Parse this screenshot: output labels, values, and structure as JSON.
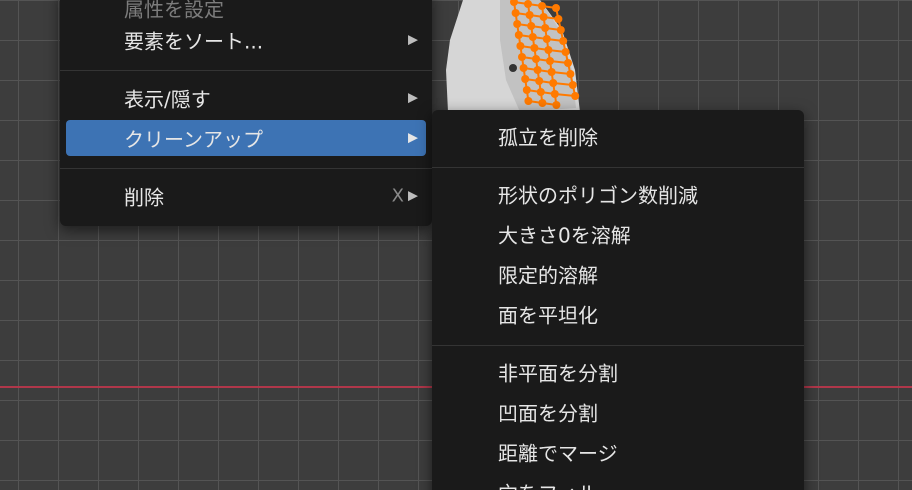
{
  "main_menu": {
    "items": [
      {
        "label": "属性を設定",
        "arrow": ""
      },
      {
        "label": "要素をソート...",
        "arrow": "▶"
      },
      {
        "label": "表示/隠す",
        "arrow": "▶"
      },
      {
        "label": "クリーンアップ",
        "arrow": "▶"
      },
      {
        "label": "削除",
        "shortcut": "X",
        "arrow": "▶"
      }
    ]
  },
  "cleanup_submenu": {
    "items": [
      {
        "label": "孤立を削除"
      },
      {
        "label": "形状のポリゴン数削減"
      },
      {
        "label": "大きさ0を溶解"
      },
      {
        "label": "限定的溶解"
      },
      {
        "label": "面を平坦化"
      },
      {
        "label": "非平面を分割"
      },
      {
        "label": "凹面を分割"
      },
      {
        "label": "距離でマージ"
      },
      {
        "label": "穴をフィル"
      }
    ]
  },
  "colors": {
    "highlight": "#3d73b4",
    "menu_bg": "#1a1a1a",
    "viewport_bg": "#3d3d3d",
    "grid_line": "#545454",
    "x_axis": "#b0374a",
    "vertex": "#ff7a00"
  }
}
